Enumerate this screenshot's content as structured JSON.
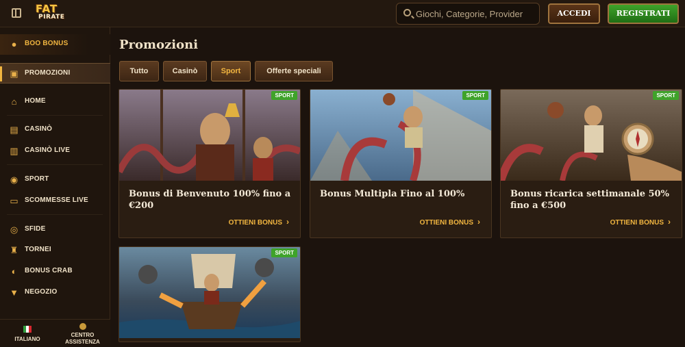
{
  "header": {
    "logo_line1": "FAT",
    "logo_line2": "PIRATE",
    "search_placeholder": "Giochi, Categorie, Provider",
    "login_label": "ACCEDI",
    "register_label": "REGISTRATI"
  },
  "sidebar": {
    "items": [
      {
        "label": "BOO BONUS",
        "icon": "pumpkin-icon"
      },
      {
        "label": "PROMOZIONI",
        "icon": "treasure-chest-icon"
      },
      {
        "label": "HOME",
        "icon": "home-icon"
      },
      {
        "label": "CASINÒ",
        "icon": "slot-machine-icon"
      },
      {
        "label": "CASINÒ LIVE",
        "icon": "cards-icon"
      },
      {
        "label": "SPORT",
        "icon": "soccer-ball-icon"
      },
      {
        "label": "SCOMMESSE LIVE",
        "icon": "live-icon"
      },
      {
        "label": "SFIDE",
        "icon": "target-icon"
      },
      {
        "label": "TORNEI",
        "icon": "trophy-icon"
      },
      {
        "label": "BONUS CRAB",
        "icon": "crab-icon"
      },
      {
        "label": "NEGOZIO",
        "icon": "shop-icon"
      }
    ],
    "language_label": "ITALIANO",
    "assist_label_1": "CENTRO",
    "assist_label_2": "ASSISTENZA"
  },
  "main": {
    "title": "Promozioni",
    "tabs": [
      {
        "label": "Tutto",
        "active": false
      },
      {
        "label": "Casinò",
        "active": false
      },
      {
        "label": "Sport",
        "active": true
      },
      {
        "label": "Offerte speciali",
        "active": false
      }
    ],
    "cards": [
      {
        "badge": "SPORT",
        "title": "Bonus di Benvenuto 100% fino a €200",
        "cta": "OTTIENI BONUS"
      },
      {
        "badge": "SPORT",
        "title": "Bonus Multipla Fino al 100%",
        "cta": "OTTIENI BONUS"
      },
      {
        "badge": "SPORT",
        "title": "Bonus ricarica settimanale 50% fino a €500",
        "cta": "OTTIENI BONUS"
      },
      {
        "badge": "SPORT",
        "title": "",
        "cta": ""
      }
    ]
  },
  "colors": {
    "accent": "#f2b640",
    "register_green": "#3fa32a",
    "badge_green": "#3fa32a",
    "background": "#1c130d"
  }
}
